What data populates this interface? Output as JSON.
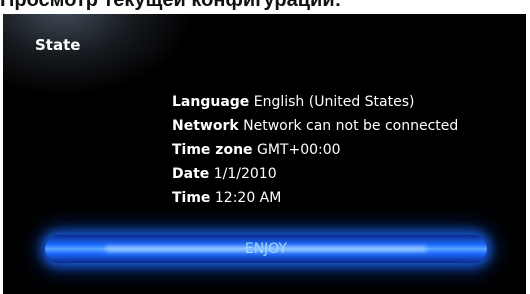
{
  "page_heading": "Просмотр текущей конфигурации:",
  "screen": {
    "title": "State",
    "info": [
      {
        "label": "Language",
        "value": "English (United States)"
      },
      {
        "label": "Network",
        "value": "Network can not be connected"
      },
      {
        "label": "Time zone",
        "value": "GMT+00:00"
      },
      {
        "label": "Date",
        "value": "1/1/2010"
      },
      {
        "label": "Time",
        "value": "12:20 AM"
      }
    ],
    "button_label": "ENJOY"
  },
  "colors": {
    "screen_background": "#000000",
    "text": "#ffffff",
    "accent_glow": "#1e6cff"
  }
}
